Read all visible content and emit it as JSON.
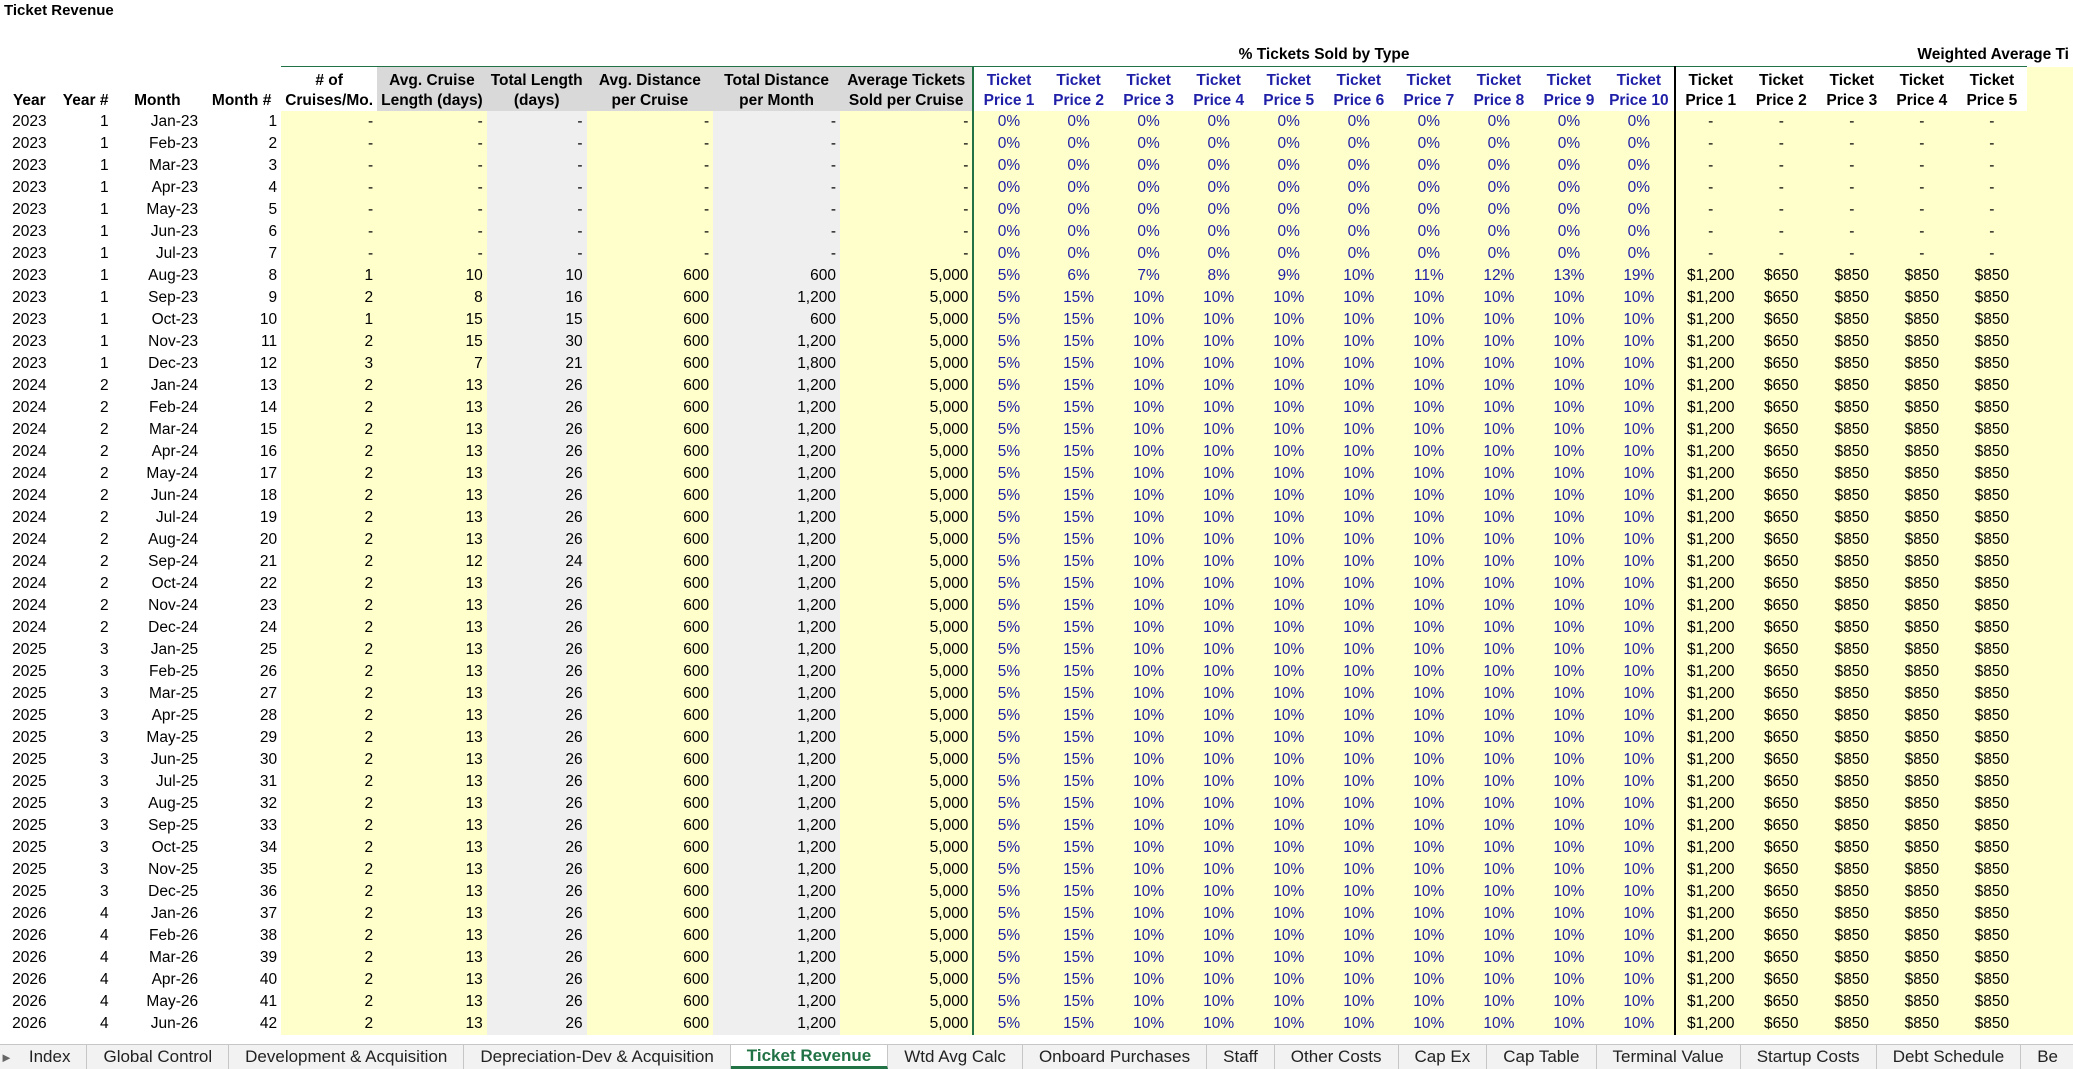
{
  "sheet_title": "Ticket Revenue",
  "group_headers": {
    "pct_sold": "% Tickets Sold by Type",
    "weighted_avg": "Weighted Average Ti"
  },
  "headers": {
    "year": "Year",
    "year_num": "Year #",
    "month": "Month",
    "month_num": "Month #",
    "cruises_l1": "# of",
    "cruises_l2": "Cruises/Mo.",
    "avg_len_l1": "Avg. Cruise",
    "avg_len_l2": "Length (days)",
    "total_len_l1": "Total Length",
    "total_len_l2": "(days)",
    "avg_dist_l1": "Avg. Distance",
    "avg_dist_l2": "per Cruise",
    "total_dist_l1": "Total Distance",
    "total_dist_l2": "per Month",
    "avg_tix_l1": "Average Tickets",
    "avg_tix_l2": "Sold per Cruise",
    "tp_l1": "Ticket",
    "tp": [
      "Price 1",
      "Price 2",
      "Price 3",
      "Price 4",
      "Price 5",
      "Price 6",
      "Price 7",
      "Price 8",
      "Price 9",
      "Price 10"
    ],
    "wp": [
      "Price 1",
      "Price 2",
      "Price 3",
      "Price 4",
      "Price 5"
    ]
  },
  "rows": [
    [
      "2023",
      "1",
      "Jan-23",
      "1",
      "-",
      "-",
      "-",
      "-",
      "-",
      "-",
      "0%",
      "0%",
      "0%",
      "0%",
      "0%",
      "0%",
      "0%",
      "0%",
      "0%",
      "0%",
      "-",
      "-",
      "-",
      "-",
      "-"
    ],
    [
      "2023",
      "1",
      "Feb-23",
      "2",
      "-",
      "-",
      "-",
      "-",
      "-",
      "-",
      "0%",
      "0%",
      "0%",
      "0%",
      "0%",
      "0%",
      "0%",
      "0%",
      "0%",
      "0%",
      "-",
      "-",
      "-",
      "-",
      "-"
    ],
    [
      "2023",
      "1",
      "Mar-23",
      "3",
      "-",
      "-",
      "-",
      "-",
      "-",
      "-",
      "0%",
      "0%",
      "0%",
      "0%",
      "0%",
      "0%",
      "0%",
      "0%",
      "0%",
      "0%",
      "-",
      "-",
      "-",
      "-",
      "-"
    ],
    [
      "2023",
      "1",
      "Apr-23",
      "4",
      "-",
      "-",
      "-",
      "-",
      "-",
      "-",
      "0%",
      "0%",
      "0%",
      "0%",
      "0%",
      "0%",
      "0%",
      "0%",
      "0%",
      "0%",
      "-",
      "-",
      "-",
      "-",
      "-"
    ],
    [
      "2023",
      "1",
      "May-23",
      "5",
      "-",
      "-",
      "-",
      "-",
      "-",
      "-",
      "0%",
      "0%",
      "0%",
      "0%",
      "0%",
      "0%",
      "0%",
      "0%",
      "0%",
      "0%",
      "-",
      "-",
      "-",
      "-",
      "-"
    ],
    [
      "2023",
      "1",
      "Jun-23",
      "6",
      "-",
      "-",
      "-",
      "-",
      "-",
      "-",
      "0%",
      "0%",
      "0%",
      "0%",
      "0%",
      "0%",
      "0%",
      "0%",
      "0%",
      "0%",
      "-",
      "-",
      "-",
      "-",
      "-"
    ],
    [
      "2023",
      "1",
      "Jul-23",
      "7",
      "-",
      "-",
      "-",
      "-",
      "-",
      "-",
      "0%",
      "0%",
      "0%",
      "0%",
      "0%",
      "0%",
      "0%",
      "0%",
      "0%",
      "0%",
      "-",
      "-",
      "-",
      "-",
      "-"
    ],
    [
      "2023",
      "1",
      "Aug-23",
      "8",
      "1",
      "10",
      "10",
      "600",
      "600",
      "5,000",
      "5%",
      "6%",
      "7%",
      "8%",
      "9%",
      "10%",
      "11%",
      "12%",
      "13%",
      "19%",
      "$1,200",
      "$650",
      "$850",
      "$850",
      "$850"
    ],
    [
      "2023",
      "1",
      "Sep-23",
      "9",
      "2",
      "8",
      "16",
      "600",
      "1,200",
      "5,000",
      "5%",
      "15%",
      "10%",
      "10%",
      "10%",
      "10%",
      "10%",
      "10%",
      "10%",
      "10%",
      "$1,200",
      "$650",
      "$850",
      "$850",
      "$850"
    ],
    [
      "2023",
      "1",
      "Oct-23",
      "10",
      "1",
      "15",
      "15",
      "600",
      "600",
      "5,000",
      "5%",
      "15%",
      "10%",
      "10%",
      "10%",
      "10%",
      "10%",
      "10%",
      "10%",
      "10%",
      "$1,200",
      "$650",
      "$850",
      "$850",
      "$850"
    ],
    [
      "2023",
      "1",
      "Nov-23",
      "11",
      "2",
      "15",
      "30",
      "600",
      "1,200",
      "5,000",
      "5%",
      "15%",
      "10%",
      "10%",
      "10%",
      "10%",
      "10%",
      "10%",
      "10%",
      "10%",
      "$1,200",
      "$650",
      "$850",
      "$850",
      "$850"
    ],
    [
      "2023",
      "1",
      "Dec-23",
      "12",
      "3",
      "7",
      "21",
      "600",
      "1,800",
      "5,000",
      "5%",
      "15%",
      "10%",
      "10%",
      "10%",
      "10%",
      "10%",
      "10%",
      "10%",
      "10%",
      "$1,200",
      "$650",
      "$850",
      "$850",
      "$850"
    ],
    [
      "2024",
      "2",
      "Jan-24",
      "13",
      "2",
      "13",
      "26",
      "600",
      "1,200",
      "5,000",
      "5%",
      "15%",
      "10%",
      "10%",
      "10%",
      "10%",
      "10%",
      "10%",
      "10%",
      "10%",
      "$1,200",
      "$650",
      "$850",
      "$850",
      "$850"
    ],
    [
      "2024",
      "2",
      "Feb-24",
      "14",
      "2",
      "13",
      "26",
      "600",
      "1,200",
      "5,000",
      "5%",
      "15%",
      "10%",
      "10%",
      "10%",
      "10%",
      "10%",
      "10%",
      "10%",
      "10%",
      "$1,200",
      "$650",
      "$850",
      "$850",
      "$850"
    ],
    [
      "2024",
      "2",
      "Mar-24",
      "15",
      "2",
      "13",
      "26",
      "600",
      "1,200",
      "5,000",
      "5%",
      "15%",
      "10%",
      "10%",
      "10%",
      "10%",
      "10%",
      "10%",
      "10%",
      "10%",
      "$1,200",
      "$650",
      "$850",
      "$850",
      "$850"
    ],
    [
      "2024",
      "2",
      "Apr-24",
      "16",
      "2",
      "13",
      "26",
      "600",
      "1,200",
      "5,000",
      "5%",
      "15%",
      "10%",
      "10%",
      "10%",
      "10%",
      "10%",
      "10%",
      "10%",
      "10%",
      "$1,200",
      "$650",
      "$850",
      "$850",
      "$850"
    ],
    [
      "2024",
      "2",
      "May-24",
      "17",
      "2",
      "13",
      "26",
      "600",
      "1,200",
      "5,000",
      "5%",
      "15%",
      "10%",
      "10%",
      "10%",
      "10%",
      "10%",
      "10%",
      "10%",
      "10%",
      "$1,200",
      "$650",
      "$850",
      "$850",
      "$850"
    ],
    [
      "2024",
      "2",
      "Jun-24",
      "18",
      "2",
      "13",
      "26",
      "600",
      "1,200",
      "5,000",
      "5%",
      "15%",
      "10%",
      "10%",
      "10%",
      "10%",
      "10%",
      "10%",
      "10%",
      "10%",
      "$1,200",
      "$650",
      "$850",
      "$850",
      "$850"
    ],
    [
      "2024",
      "2",
      "Jul-24",
      "19",
      "2",
      "13",
      "26",
      "600",
      "1,200",
      "5,000",
      "5%",
      "15%",
      "10%",
      "10%",
      "10%",
      "10%",
      "10%",
      "10%",
      "10%",
      "10%",
      "$1,200",
      "$650",
      "$850",
      "$850",
      "$850"
    ],
    [
      "2024",
      "2",
      "Aug-24",
      "20",
      "2",
      "13",
      "26",
      "600",
      "1,200",
      "5,000",
      "5%",
      "15%",
      "10%",
      "10%",
      "10%",
      "10%",
      "10%",
      "10%",
      "10%",
      "10%",
      "$1,200",
      "$650",
      "$850",
      "$850",
      "$850"
    ],
    [
      "2024",
      "2",
      "Sep-24",
      "21",
      "2",
      "12",
      "24",
      "600",
      "1,200",
      "5,000",
      "5%",
      "15%",
      "10%",
      "10%",
      "10%",
      "10%",
      "10%",
      "10%",
      "10%",
      "10%",
      "$1,200",
      "$650",
      "$850",
      "$850",
      "$850"
    ],
    [
      "2024",
      "2",
      "Oct-24",
      "22",
      "2",
      "13",
      "26",
      "600",
      "1,200",
      "5,000",
      "5%",
      "15%",
      "10%",
      "10%",
      "10%",
      "10%",
      "10%",
      "10%",
      "10%",
      "10%",
      "$1,200",
      "$650",
      "$850",
      "$850",
      "$850"
    ],
    [
      "2024",
      "2",
      "Nov-24",
      "23",
      "2",
      "13",
      "26",
      "600",
      "1,200",
      "5,000",
      "5%",
      "15%",
      "10%",
      "10%",
      "10%",
      "10%",
      "10%",
      "10%",
      "10%",
      "10%",
      "$1,200",
      "$650",
      "$850",
      "$850",
      "$850"
    ],
    [
      "2024",
      "2",
      "Dec-24",
      "24",
      "2",
      "13",
      "26",
      "600",
      "1,200",
      "5,000",
      "5%",
      "15%",
      "10%",
      "10%",
      "10%",
      "10%",
      "10%",
      "10%",
      "10%",
      "10%",
      "$1,200",
      "$650",
      "$850",
      "$850",
      "$850"
    ],
    [
      "2025",
      "3",
      "Jan-25",
      "25",
      "2",
      "13",
      "26",
      "600",
      "1,200",
      "5,000",
      "5%",
      "15%",
      "10%",
      "10%",
      "10%",
      "10%",
      "10%",
      "10%",
      "10%",
      "10%",
      "$1,200",
      "$650",
      "$850",
      "$850",
      "$850"
    ],
    [
      "2025",
      "3",
      "Feb-25",
      "26",
      "2",
      "13",
      "26",
      "600",
      "1,200",
      "5,000",
      "5%",
      "15%",
      "10%",
      "10%",
      "10%",
      "10%",
      "10%",
      "10%",
      "10%",
      "10%",
      "$1,200",
      "$650",
      "$850",
      "$850",
      "$850"
    ],
    [
      "2025",
      "3",
      "Mar-25",
      "27",
      "2",
      "13",
      "26",
      "600",
      "1,200",
      "5,000",
      "5%",
      "15%",
      "10%",
      "10%",
      "10%",
      "10%",
      "10%",
      "10%",
      "10%",
      "10%",
      "$1,200",
      "$650",
      "$850",
      "$850",
      "$850"
    ],
    [
      "2025",
      "3",
      "Apr-25",
      "28",
      "2",
      "13",
      "26",
      "600",
      "1,200",
      "5,000",
      "5%",
      "15%",
      "10%",
      "10%",
      "10%",
      "10%",
      "10%",
      "10%",
      "10%",
      "10%",
      "$1,200",
      "$650",
      "$850",
      "$850",
      "$850"
    ],
    [
      "2025",
      "3",
      "May-25",
      "29",
      "2",
      "13",
      "26",
      "600",
      "1,200",
      "5,000",
      "5%",
      "15%",
      "10%",
      "10%",
      "10%",
      "10%",
      "10%",
      "10%",
      "10%",
      "10%",
      "$1,200",
      "$650",
      "$850",
      "$850",
      "$850"
    ],
    [
      "2025",
      "3",
      "Jun-25",
      "30",
      "2",
      "13",
      "26",
      "600",
      "1,200",
      "5,000",
      "5%",
      "15%",
      "10%",
      "10%",
      "10%",
      "10%",
      "10%",
      "10%",
      "10%",
      "10%",
      "$1,200",
      "$650",
      "$850",
      "$850",
      "$850"
    ],
    [
      "2025",
      "3",
      "Jul-25",
      "31",
      "2",
      "13",
      "26",
      "600",
      "1,200",
      "5,000",
      "5%",
      "15%",
      "10%",
      "10%",
      "10%",
      "10%",
      "10%",
      "10%",
      "10%",
      "10%",
      "$1,200",
      "$650",
      "$850",
      "$850",
      "$850"
    ],
    [
      "2025",
      "3",
      "Aug-25",
      "32",
      "2",
      "13",
      "26",
      "600",
      "1,200",
      "5,000",
      "5%",
      "15%",
      "10%",
      "10%",
      "10%",
      "10%",
      "10%",
      "10%",
      "10%",
      "10%",
      "$1,200",
      "$650",
      "$850",
      "$850",
      "$850"
    ],
    [
      "2025",
      "3",
      "Sep-25",
      "33",
      "2",
      "13",
      "26",
      "600",
      "1,200",
      "5,000",
      "5%",
      "15%",
      "10%",
      "10%",
      "10%",
      "10%",
      "10%",
      "10%",
      "10%",
      "10%",
      "$1,200",
      "$650",
      "$850",
      "$850",
      "$850"
    ],
    [
      "2025",
      "3",
      "Oct-25",
      "34",
      "2",
      "13",
      "26",
      "600",
      "1,200",
      "5,000",
      "5%",
      "15%",
      "10%",
      "10%",
      "10%",
      "10%",
      "10%",
      "10%",
      "10%",
      "10%",
      "$1,200",
      "$650",
      "$850",
      "$850",
      "$850"
    ],
    [
      "2025",
      "3",
      "Nov-25",
      "35",
      "2",
      "13",
      "26",
      "600",
      "1,200",
      "5,000",
      "5%",
      "15%",
      "10%",
      "10%",
      "10%",
      "10%",
      "10%",
      "10%",
      "10%",
      "10%",
      "$1,200",
      "$650",
      "$850",
      "$850",
      "$850"
    ],
    [
      "2025",
      "3",
      "Dec-25",
      "36",
      "2",
      "13",
      "26",
      "600",
      "1,200",
      "5,000",
      "5%",
      "15%",
      "10%",
      "10%",
      "10%",
      "10%",
      "10%",
      "10%",
      "10%",
      "10%",
      "$1,200",
      "$650",
      "$850",
      "$850",
      "$850"
    ],
    [
      "2026",
      "4",
      "Jan-26",
      "37",
      "2",
      "13",
      "26",
      "600",
      "1,200",
      "5,000",
      "5%",
      "15%",
      "10%",
      "10%",
      "10%",
      "10%",
      "10%",
      "10%",
      "10%",
      "10%",
      "$1,200",
      "$650",
      "$850",
      "$850",
      "$850"
    ],
    [
      "2026",
      "4",
      "Feb-26",
      "38",
      "2",
      "13",
      "26",
      "600",
      "1,200",
      "5,000",
      "5%",
      "15%",
      "10%",
      "10%",
      "10%",
      "10%",
      "10%",
      "10%",
      "10%",
      "10%",
      "$1,200",
      "$650",
      "$850",
      "$850",
      "$850"
    ],
    [
      "2026",
      "4",
      "Mar-26",
      "39",
      "2",
      "13",
      "26",
      "600",
      "1,200",
      "5,000",
      "5%",
      "15%",
      "10%",
      "10%",
      "10%",
      "10%",
      "10%",
      "10%",
      "10%",
      "10%",
      "$1,200",
      "$650",
      "$850",
      "$850",
      "$850"
    ],
    [
      "2026",
      "4",
      "Apr-26",
      "40",
      "2",
      "13",
      "26",
      "600",
      "1,200",
      "5,000",
      "5%",
      "15%",
      "10%",
      "10%",
      "10%",
      "10%",
      "10%",
      "10%",
      "10%",
      "10%",
      "$1,200",
      "$650",
      "$850",
      "$850",
      "$850"
    ],
    [
      "2026",
      "4",
      "May-26",
      "41",
      "2",
      "13",
      "26",
      "600",
      "1,200",
      "5,000",
      "5%",
      "15%",
      "10%",
      "10%",
      "10%",
      "10%",
      "10%",
      "10%",
      "10%",
      "10%",
      "$1,200",
      "$650",
      "$850",
      "$850",
      "$850"
    ],
    [
      "2026",
      "4",
      "Jun-26",
      "42",
      "2",
      "13",
      "26",
      "600",
      "1,200",
      "5,000",
      "5%",
      "15%",
      "10%",
      "10%",
      "10%",
      "10%",
      "10%",
      "10%",
      "10%",
      "10%",
      "$1,200",
      "$650",
      "$850",
      "$850",
      "$850"
    ]
  ],
  "tabs": [
    {
      "label": "Index",
      "active": false
    },
    {
      "label": "Global Control",
      "active": false
    },
    {
      "label": "Development & Acquisition",
      "active": false
    },
    {
      "label": "Depreciation-Dev & Acquisition",
      "active": false
    },
    {
      "label": "Ticket Revenue",
      "active": true
    },
    {
      "label": "Wtd Avg Calc",
      "active": false
    },
    {
      "label": "Onboard Purchases",
      "active": false
    },
    {
      "label": "Staff",
      "active": false
    },
    {
      "label": "Other Costs",
      "active": false
    },
    {
      "label": "Cap Ex",
      "active": false
    },
    {
      "label": "Cap Table",
      "active": false
    },
    {
      "label": "Terminal Value",
      "active": false
    },
    {
      "label": "Startup Costs",
      "active": false
    },
    {
      "label": "Debt Schedule",
      "active": false
    },
    {
      "label": "Be",
      "active": false
    }
  ],
  "nav_arrow": "►",
  "colors": {
    "input_yellow": "#ffffcc",
    "header_gray": "#d9d9d9",
    "calc_gray": "#efefef",
    "input_blue": "#1f1fa8",
    "excel_green": "#217346"
  }
}
